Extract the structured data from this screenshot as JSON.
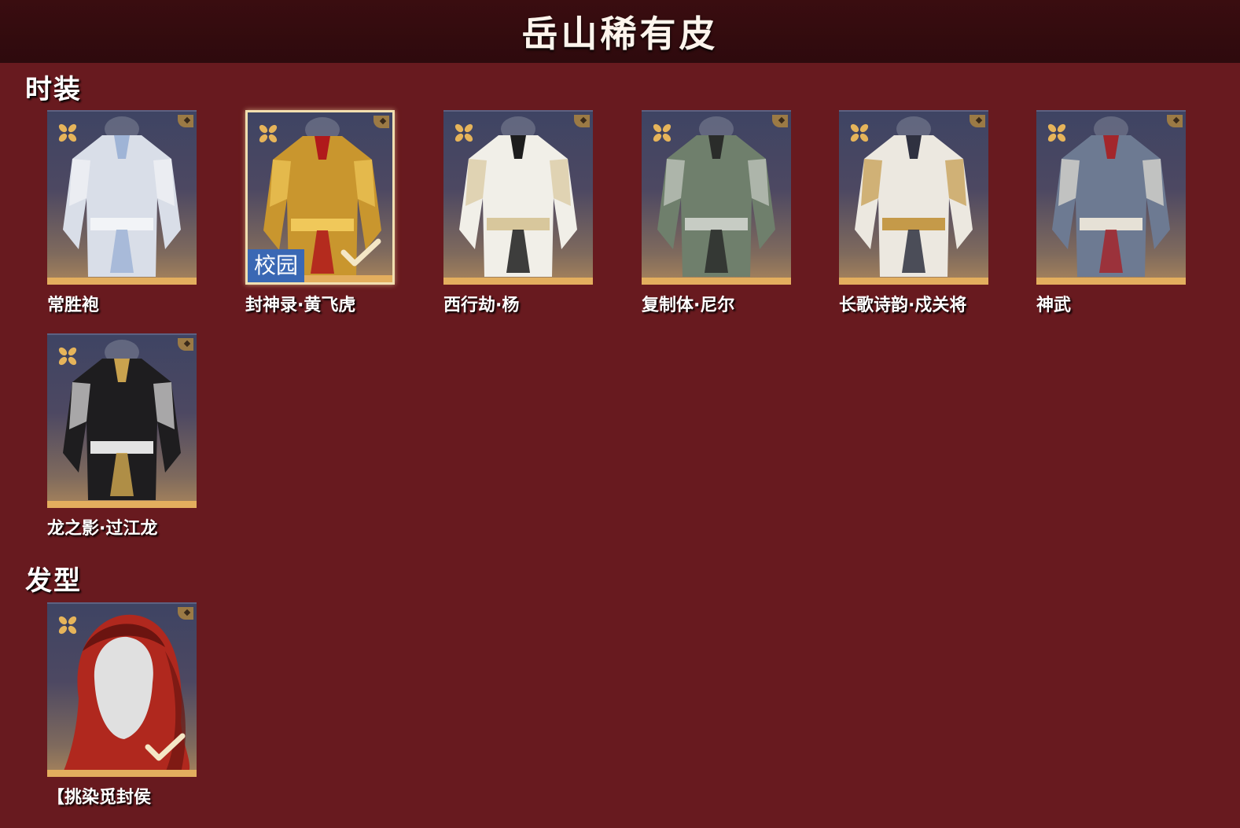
{
  "header": {
    "title": "岳山稀有皮"
  },
  "sections": [
    {
      "title": "时装",
      "items": [
        {
          "label": "常胜袍",
          "selected": false,
          "tag": "",
          "owned": false,
          "palette": {
            "main": "#d9dee8",
            "accent": "#9fb4d6",
            "trim": "#f2f4f7"
          }
        },
        {
          "label": "封神录·黄飞虎",
          "selected": true,
          "tag": "校园",
          "owned": true,
          "palette": {
            "main": "#c9962e",
            "accent": "#b0191b",
            "trim": "#f0c85a"
          }
        },
        {
          "label": "西行劫·杨",
          "selected": false,
          "tag": "",
          "owned": false,
          "palette": {
            "main": "#f1efe8",
            "accent": "#1d1d1d",
            "trim": "#d8c79c"
          }
        },
        {
          "label": "复制体·尼尔",
          "selected": false,
          "tag": "",
          "owned": false,
          "palette": {
            "main": "#6f7f6c",
            "accent": "#2a2c2a",
            "trim": "#c7ccc4"
          }
        },
        {
          "label": "长歌诗韵·戍关将",
          "selected": false,
          "tag": "",
          "owned": false,
          "palette": {
            "main": "#ece8e0",
            "accent": "#2f3140",
            "trim": "#c59a49"
          }
        },
        {
          "label": "神武",
          "selected": false,
          "tag": "",
          "owned": false,
          "palette": {
            "main": "#6d7a92",
            "accent": "#a3262b",
            "trim": "#e6e1d6"
          }
        },
        {
          "label": "龙之影·过江龙",
          "selected": false,
          "tag": "",
          "owned": false,
          "palette": {
            "main": "#1e1d1f",
            "accent": "#c9a24e",
            "trim": "#e3e3e3"
          }
        }
      ]
    },
    {
      "title": "发型",
      "items": [
        {
          "label": "【挑染觅封侯",
          "selected": false,
          "tag": "",
          "owned": true,
          "palette": {
            "main": "#b0281e",
            "accent": "#e0e0e0",
            "trim": "#6b1410"
          }
        }
      ]
    }
  ],
  "icons": {
    "rarity": "clover-icon",
    "corner": "corner-badge-icon",
    "owned": "checkmark-icon"
  },
  "colors": {
    "background": "#681a1f",
    "header": "#2e0a0d",
    "card_bar": "#e3ae5e",
    "tag": "#3a68b4"
  }
}
